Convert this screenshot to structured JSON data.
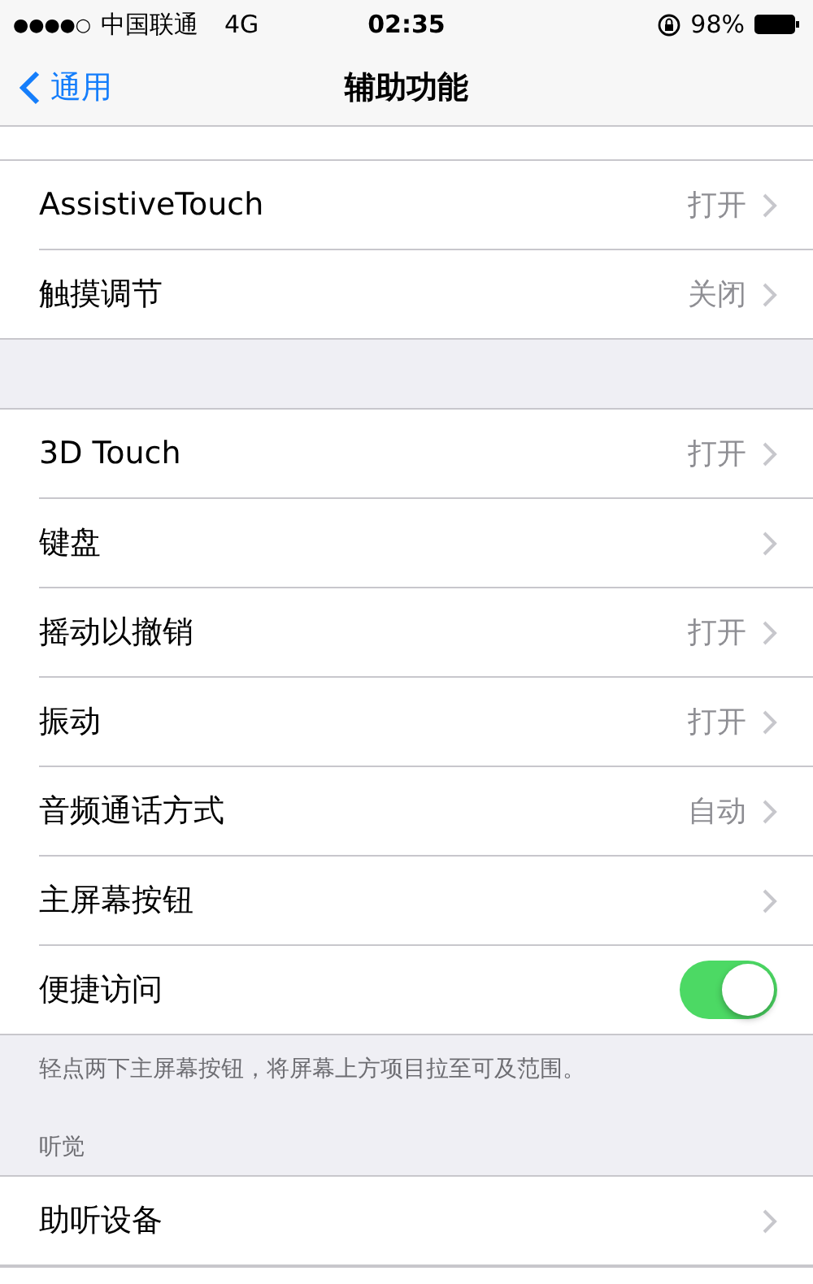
{
  "status_bar": {
    "signal": "●●●●○",
    "carrier": "中国联通",
    "network": "4G",
    "time": "02:35",
    "battery": "98%"
  },
  "nav": {
    "back": "通用",
    "title": "辅助功能"
  },
  "groups": [
    {
      "rows": [
        {
          "kind": "link",
          "label": "AssistiveTouch",
          "value": "打开"
        },
        {
          "kind": "link",
          "label": "触摸调节",
          "value": "关闭"
        }
      ]
    },
    {
      "rows": [
        {
          "kind": "link",
          "label": "3D Touch",
          "value": "打开"
        },
        {
          "kind": "link",
          "label": "键盘"
        },
        {
          "kind": "link",
          "label": "摇动以撤销",
          "value": "打开"
        },
        {
          "kind": "link",
          "label": "振动",
          "value": "打开"
        },
        {
          "kind": "link",
          "label": "音频通话方式",
          "value": "自动"
        },
        {
          "kind": "link",
          "label": "主屏幕按钮"
        },
        {
          "kind": "toggle",
          "label": "便捷访问",
          "on": true
        }
      ],
      "footer": "轻点两下主屏幕按钮，将屏幕上方项目拉至可及范围。"
    },
    {
      "header": "听觉",
      "rows": [
        {
          "kind": "link",
          "label": "助听设备"
        }
      ]
    }
  ]
}
